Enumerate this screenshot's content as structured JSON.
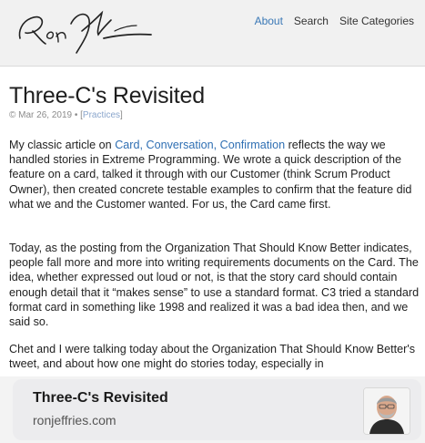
{
  "header": {
    "logo_alt": "Ron Jeffries signature",
    "nav": [
      {
        "label": "About",
        "active": true
      },
      {
        "label": "Search",
        "active": false
      },
      {
        "label": "Site Categories",
        "active": false
      }
    ]
  },
  "article": {
    "title": "Three-C's Revisited",
    "meta_prefix": "© Mar 26, 2019 • [",
    "meta_category": "Practices",
    "meta_suffix": "]",
    "p1": {
      "before": "My classic article on ",
      "link": "Card, Conversation, Confirmation",
      "after": " reflects the way we handled stories in Extreme Programming. We wrote a quick description of the feature on a card, talked it through with our Customer (think Scrum Product Owner), then created concrete testable examples to confirm that the feature did what we and the Customer wanted. For us, the Card came first."
    },
    "p2": "Today, as the posting from the Organization That Should Know Better indicates, people fall more and more into writing requirements documents on the Card. The idea, whether expressed out loud or not, is that the story card should contain enough detail that it “makes sense” to use a standard format. C3 tried a standard format card in something like 1998 and realized it was a bad idea then, and we said so.",
    "p3": "Chet and I were talking today about the Organization That Should Know Better's tweet, and about how one might do stories today, especially in"
  },
  "preview_card": {
    "title": "Three-C's Revisited",
    "domain": "ronjeffries.com",
    "thumbnail": "author-photo"
  },
  "colors": {
    "accent": "#3a78b6",
    "link": "#2f6fb3",
    "card_bg": "#ececee"
  }
}
